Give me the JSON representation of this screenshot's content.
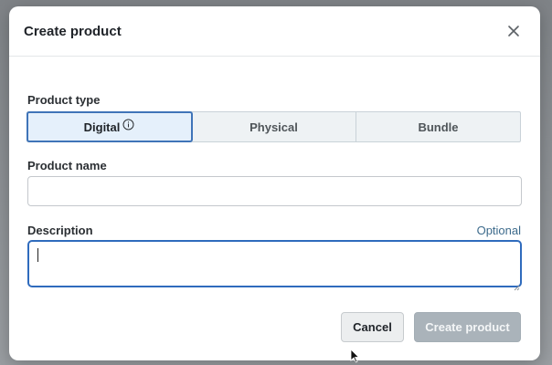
{
  "dialog": {
    "title": "Create product",
    "close_icon": "close-icon"
  },
  "product_type": {
    "label": "Product type",
    "options": [
      {
        "label": "Digital",
        "selected": true,
        "info_icon": "info-icon"
      },
      {
        "label": "Physical",
        "selected": false
      },
      {
        "label": "Bundle",
        "selected": false
      }
    ]
  },
  "product_name": {
    "label": "Product name",
    "value": "",
    "placeholder": ""
  },
  "description": {
    "label": "Description",
    "hint": "Optional",
    "value": ""
  },
  "actions": {
    "cancel_label": "Cancel",
    "create_label": "Create product",
    "create_disabled": true
  },
  "colors": {
    "accent": "#2f6bbd",
    "selected_bg": "#e5f0fb",
    "disabled_button": "#aab3ba"
  }
}
